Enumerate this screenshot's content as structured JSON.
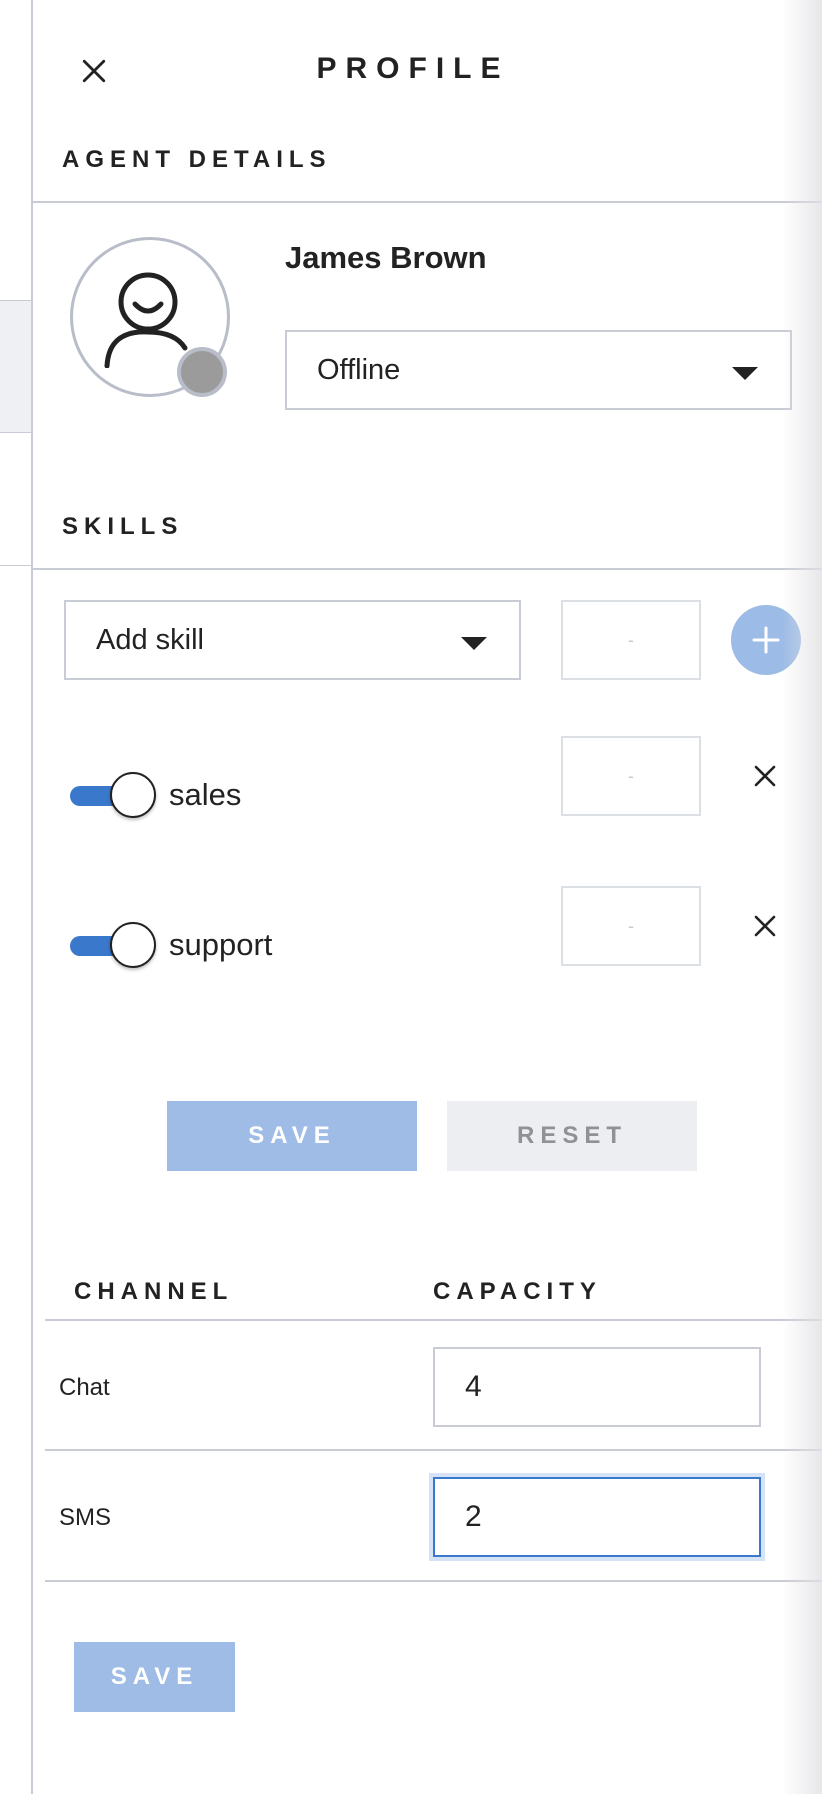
{
  "panel": {
    "title": "PROFILE"
  },
  "agent_details": {
    "heading": "AGENT DETAILS",
    "name": "James Brown",
    "status": "Offline"
  },
  "skills": {
    "heading": "SKILLS",
    "add_placeholder": "Add skill",
    "add_level_placeholder": "-",
    "items": [
      {
        "label": "sales",
        "enabled": true,
        "level_placeholder": "-"
      },
      {
        "label": "support",
        "enabled": true,
        "level_placeholder": "-"
      }
    ],
    "save_label": "SAVE",
    "reset_label": "RESET"
  },
  "channels": {
    "col_channel": "CHANNEL",
    "col_capacity": "CAPACITY",
    "rows": [
      {
        "channel": "Chat",
        "capacity": "4"
      },
      {
        "channel": "SMS",
        "capacity": "2"
      }
    ],
    "save_label": "SAVE"
  },
  "icons": {
    "close": "close-icon",
    "avatar": "user-icon",
    "add": "plus-icon",
    "remove": "close-icon",
    "dropdown": "caret-down-icon"
  },
  "colors": {
    "accent": "#3a78cc",
    "save_button": "#9ebce5",
    "reset_button": "#eceef1",
    "status_offline": "#9b9b9b",
    "divider": "#c9ccd4"
  }
}
